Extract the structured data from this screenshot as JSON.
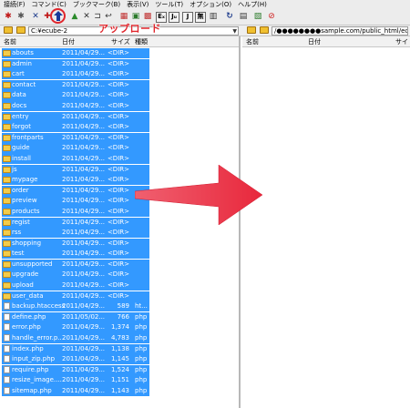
{
  "menu": [
    "接続(F)",
    "コマンド(C)",
    "ブックマーク(B)",
    "表示(V)",
    "ツール(T)",
    "オプション(O)",
    "ヘルプ(H)"
  ],
  "toolbar_icons": [
    "connect-icon",
    "disconnect-icon",
    "download-icon",
    "upload-icon",
    "delete-icon",
    "rename-icon",
    "refresh-icon",
    "view-icon",
    "edit-icon",
    "mkdir-icon",
    "ex-icon",
    "ju-icon",
    "j-icon",
    "kanji-icon",
    "sync-icon",
    "settings-icon",
    "stop-icon"
  ],
  "toolbar_glyphs": {
    "ex": "Eₓ",
    "ju": "Jᵤ",
    "j": "J",
    "kanji": "無"
  },
  "annotation": "アップロード",
  "left": {
    "path": "C:¥ecube-2",
    "columns": {
      "name": "名前",
      "date": "日付",
      "size": "サイズ",
      "type": "種類"
    },
    "files": [
      {
        "name": "abouts",
        "date": "2011/04/29...",
        "size": "<DIR>",
        "type": "",
        "kind": "folder"
      },
      {
        "name": "admin",
        "date": "2011/04/29...",
        "size": "<DIR>",
        "type": "",
        "kind": "folder"
      },
      {
        "name": "cart",
        "date": "2011/04/29...",
        "size": "<DIR>",
        "type": "",
        "kind": "folder"
      },
      {
        "name": "contact",
        "date": "2011/04/29...",
        "size": "<DIR>",
        "type": "",
        "kind": "folder"
      },
      {
        "name": "data",
        "date": "2011/04/29...",
        "size": "<DIR>",
        "type": "",
        "kind": "folder"
      },
      {
        "name": "docs",
        "date": "2011/04/29...",
        "size": "<DIR>",
        "type": "",
        "kind": "folder"
      },
      {
        "name": "entry",
        "date": "2011/04/29...",
        "size": "<DIR>",
        "type": "",
        "kind": "folder"
      },
      {
        "name": "forgot",
        "date": "2011/04/29...",
        "size": "<DIR>",
        "type": "",
        "kind": "folder"
      },
      {
        "name": "frontparts",
        "date": "2011/04/29...",
        "size": "<DIR>",
        "type": "",
        "kind": "folder"
      },
      {
        "name": "guide",
        "date": "2011/04/29...",
        "size": "<DIR>",
        "type": "",
        "kind": "folder"
      },
      {
        "name": "install",
        "date": "2011/04/29...",
        "size": "<DIR>",
        "type": "",
        "kind": "folder"
      },
      {
        "name": "js",
        "date": "2011/04/29...",
        "size": "<DIR>",
        "type": "",
        "kind": "folder"
      },
      {
        "name": "mypage",
        "date": "2011/04/29...",
        "size": "<DIR>",
        "type": "",
        "kind": "folder"
      },
      {
        "name": "order",
        "date": "2011/04/29...",
        "size": "<DIR>",
        "type": "",
        "kind": "folder"
      },
      {
        "name": "preview",
        "date": "2011/04/29...",
        "size": "<DIR>",
        "type": "",
        "kind": "folder"
      },
      {
        "name": "products",
        "date": "2011/04/29...",
        "size": "<DIR>",
        "type": "",
        "kind": "folder"
      },
      {
        "name": "regist",
        "date": "2011/04/29...",
        "size": "<DIR>",
        "type": "",
        "kind": "folder"
      },
      {
        "name": "rss",
        "date": "2011/04/29...",
        "size": "<DIR>",
        "type": "",
        "kind": "folder"
      },
      {
        "name": "shopping",
        "date": "2011/04/29...",
        "size": "<DIR>",
        "type": "",
        "kind": "folder"
      },
      {
        "name": "test",
        "date": "2011/04/29...",
        "size": "<DIR>",
        "type": "",
        "kind": "folder"
      },
      {
        "name": "unsupported",
        "date": "2011/04/29...",
        "size": "<DIR>",
        "type": "",
        "kind": "folder"
      },
      {
        "name": "upgrade",
        "date": "2011/04/29...",
        "size": "<DIR>",
        "type": "",
        "kind": "folder"
      },
      {
        "name": "upload",
        "date": "2011/04/29...",
        "size": "<DIR>",
        "type": "",
        "kind": "folder"
      },
      {
        "name": "user_data",
        "date": "2011/04/29...",
        "size": "<DIR>",
        "type": "",
        "kind": "folder"
      },
      {
        "name": "backup.htaccess",
        "date": "2011/04/29...",
        "size": "589",
        "type": "ht...",
        "kind": "file"
      },
      {
        "name": "define.php",
        "date": "2011/05/02...",
        "size": "766",
        "type": "php",
        "kind": "file"
      },
      {
        "name": "error.php",
        "date": "2011/04/29...",
        "size": "1,374",
        "type": "php",
        "kind": "file"
      },
      {
        "name": "handle_error.p...",
        "date": "2011/04/29...",
        "size": "4,783",
        "type": "php",
        "kind": "file"
      },
      {
        "name": "index.php",
        "date": "2011/04/29...",
        "size": "1,138",
        "type": "php",
        "kind": "file"
      },
      {
        "name": "input_zip.php",
        "date": "2011/04/29...",
        "size": "1,145",
        "type": "php",
        "kind": "file"
      },
      {
        "name": "require.php",
        "date": "2011/04/29...",
        "size": "1,524",
        "type": "php",
        "kind": "file"
      },
      {
        "name": "resize_image....",
        "date": "2011/04/29...",
        "size": "1,151",
        "type": "php",
        "kind": "file"
      },
      {
        "name": "sitemap.php",
        "date": "2011/04/29...",
        "size": "1,143",
        "type": "php",
        "kind": "file"
      }
    ]
  },
  "right": {
    "path": "/●●●●●●●●sample.com/public_html/ec/",
    "columns": {
      "name": "名前",
      "date": "日付",
      "size": "サイ"
    }
  },
  "colors": {
    "selection": "#3399ff",
    "accent": "#e0262c",
    "arrow": "#ee3e4f"
  }
}
